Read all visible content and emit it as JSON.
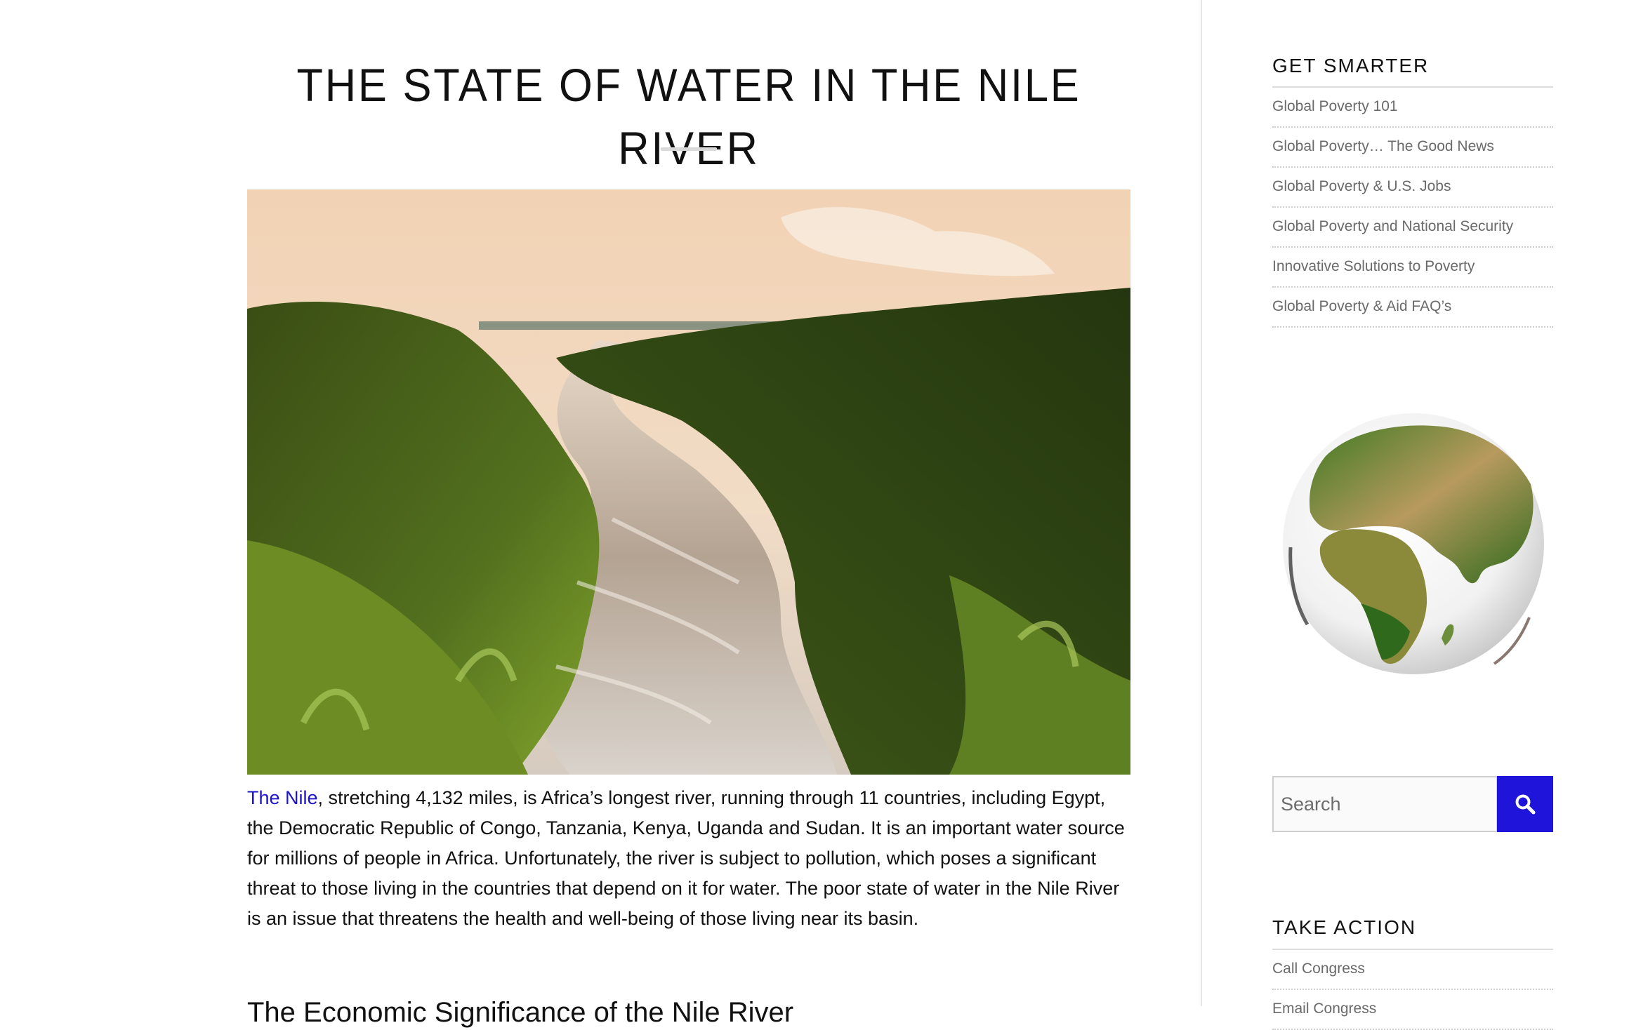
{
  "article": {
    "title": "THE STATE OF WATER IN THE NILE RIVER",
    "intro_link": "The Nile",
    "intro_text": ", stretching 4,132 miles, is Africa’s longest river, running through 11 countries, including Egypt, the Democratic Republic of Congo, Tanzania, Kenya, Uganda and Sudan. It is an important water source for millions of people in Africa. Unfortunately, the river is subject to pollution, which poses a significant threat to those living in the countries that depend on it for water. The poor state of water in the Nile River is an issue that threatens the health and well-being of those living near its basin.",
    "next_heading": "The Economic Significance of the Nile River"
  },
  "sidebar": {
    "get_smarter": {
      "title": "GET SMARTER",
      "links": [
        "Global Poverty 101",
        "Global Poverty… The Good News",
        "Global Poverty & U.S. Jobs",
        "Global Poverty and National Security",
        "Innovative Solutions to Poverty",
        "Global Poverty & Aid FAQ’s"
      ]
    },
    "search": {
      "placeholder": "Search"
    },
    "take_action": {
      "title": "TAKE ACTION",
      "links": [
        "Call Congress",
        "Email Congress"
      ]
    }
  },
  "colors": {
    "link": "#1d14c9",
    "search_button": "#1f14d9",
    "sidebar_link": "#6a6a6a"
  },
  "icons": {
    "search": "search-icon",
    "globe": "globe-illustration"
  }
}
